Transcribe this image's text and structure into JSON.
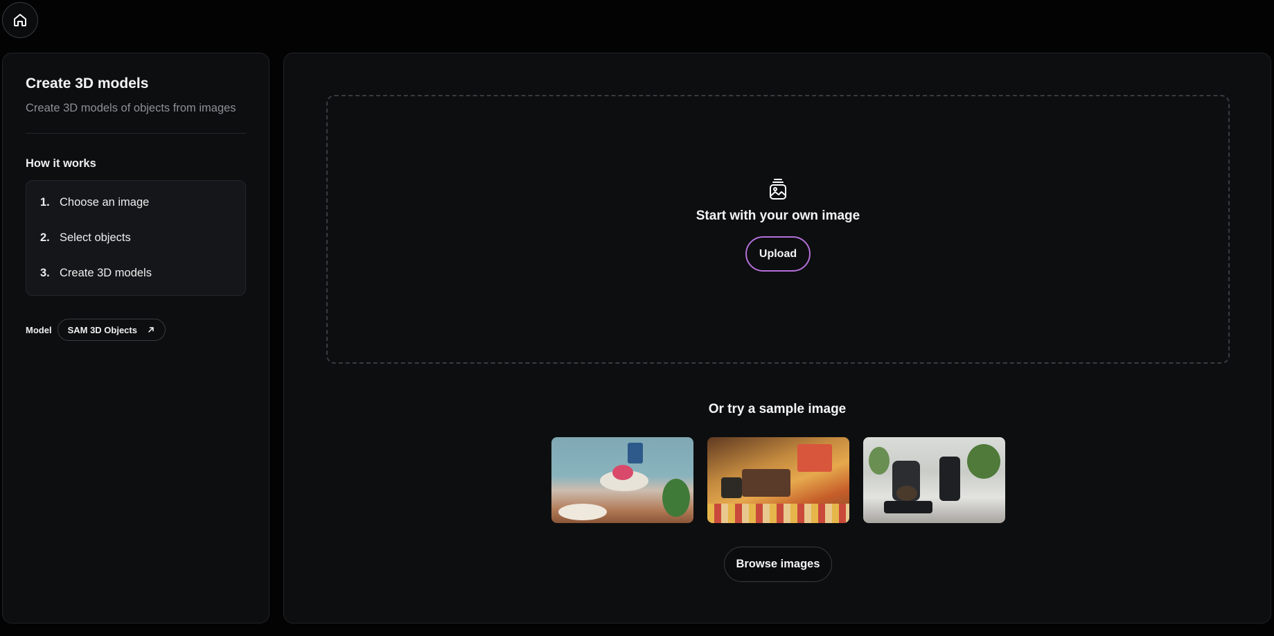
{
  "sidebar": {
    "title": "Create 3D models",
    "subtitle": "Create 3D models of objects from images",
    "how_heading": "How it works",
    "steps": [
      {
        "num": "1.",
        "label": "Choose an image"
      },
      {
        "num": "2.",
        "label": "Select objects"
      },
      {
        "num": "3.",
        "label": "Create 3D models"
      }
    ],
    "model_label": "Model",
    "model_chip": "SAM 3D Objects"
  },
  "main": {
    "start_text": "Start with your own image",
    "upload_label": "Upload",
    "or_text": "Or try a sample image",
    "browse_label": "Browse images"
  },
  "icons": {
    "home": "home-icon",
    "image": "image-icon",
    "external": "arrow-up-right-icon"
  },
  "colors": {
    "background": "#030304",
    "panel": "#0d0e10",
    "upload_border": "#b470d9"
  }
}
